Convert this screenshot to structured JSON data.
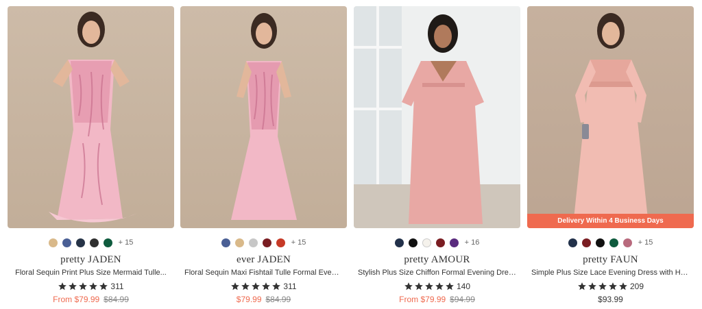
{
  "products": [
    {
      "brand": "pretty JADEN",
      "title": "Floral Sequin Print Plus Size Mermaid Tulle...",
      "rating_count": "311",
      "price_prefix": "From ",
      "price": "$79.99",
      "old_price": "$84.99",
      "swatches": [
        "#d9b98a",
        "#4a5f95",
        "#263447",
        "#2f2f2f",
        "#0f5b3e"
      ],
      "more_colors": "+ 15",
      "badge": ""
    },
    {
      "brand": "ever JADEN",
      "title": "Floral Sequin Maxi Fishtail Tulle Formal Evening...",
      "rating_count": "311",
      "price_prefix": "",
      "price": "$79.99",
      "old_price": "$84.99",
      "swatches": [
        "#4a5f95",
        "#d9b98a",
        "#c7c7c7",
        "#7a1d22",
        "#c63a27"
      ],
      "more_colors": "+ 15",
      "badge": ""
    },
    {
      "brand": "pretty AMOUR",
      "title": "Stylish Plus Size Chiffon Formal Evening Dresses...",
      "rating_count": "140",
      "price_prefix": "From ",
      "price": "$79.99",
      "old_price": "$94.99",
      "swatches": [
        "#22314a",
        "#111111",
        "#f5f2ec",
        "#7a1d22",
        "#5a2b7e"
      ],
      "more_colors": "+ 16",
      "badge": ""
    },
    {
      "brand": "pretty FAUN",
      "title": "Simple Plus Size Lace Evening Dress with Half...",
      "rating_count": "209",
      "price_prefix": "",
      "price": "$93.99",
      "old_price": "",
      "swatches": [
        "#22314a",
        "#7a1d22",
        "#111111",
        "#0f5b3e",
        "#b86a7d"
      ],
      "more_colors": "+ 15",
      "badge": "Delivery Within 4 Business Days"
    }
  ],
  "colors": {
    "sale": "#ef6a4f",
    "star": "#333333",
    "badge_bg": "#ef6a4f"
  }
}
